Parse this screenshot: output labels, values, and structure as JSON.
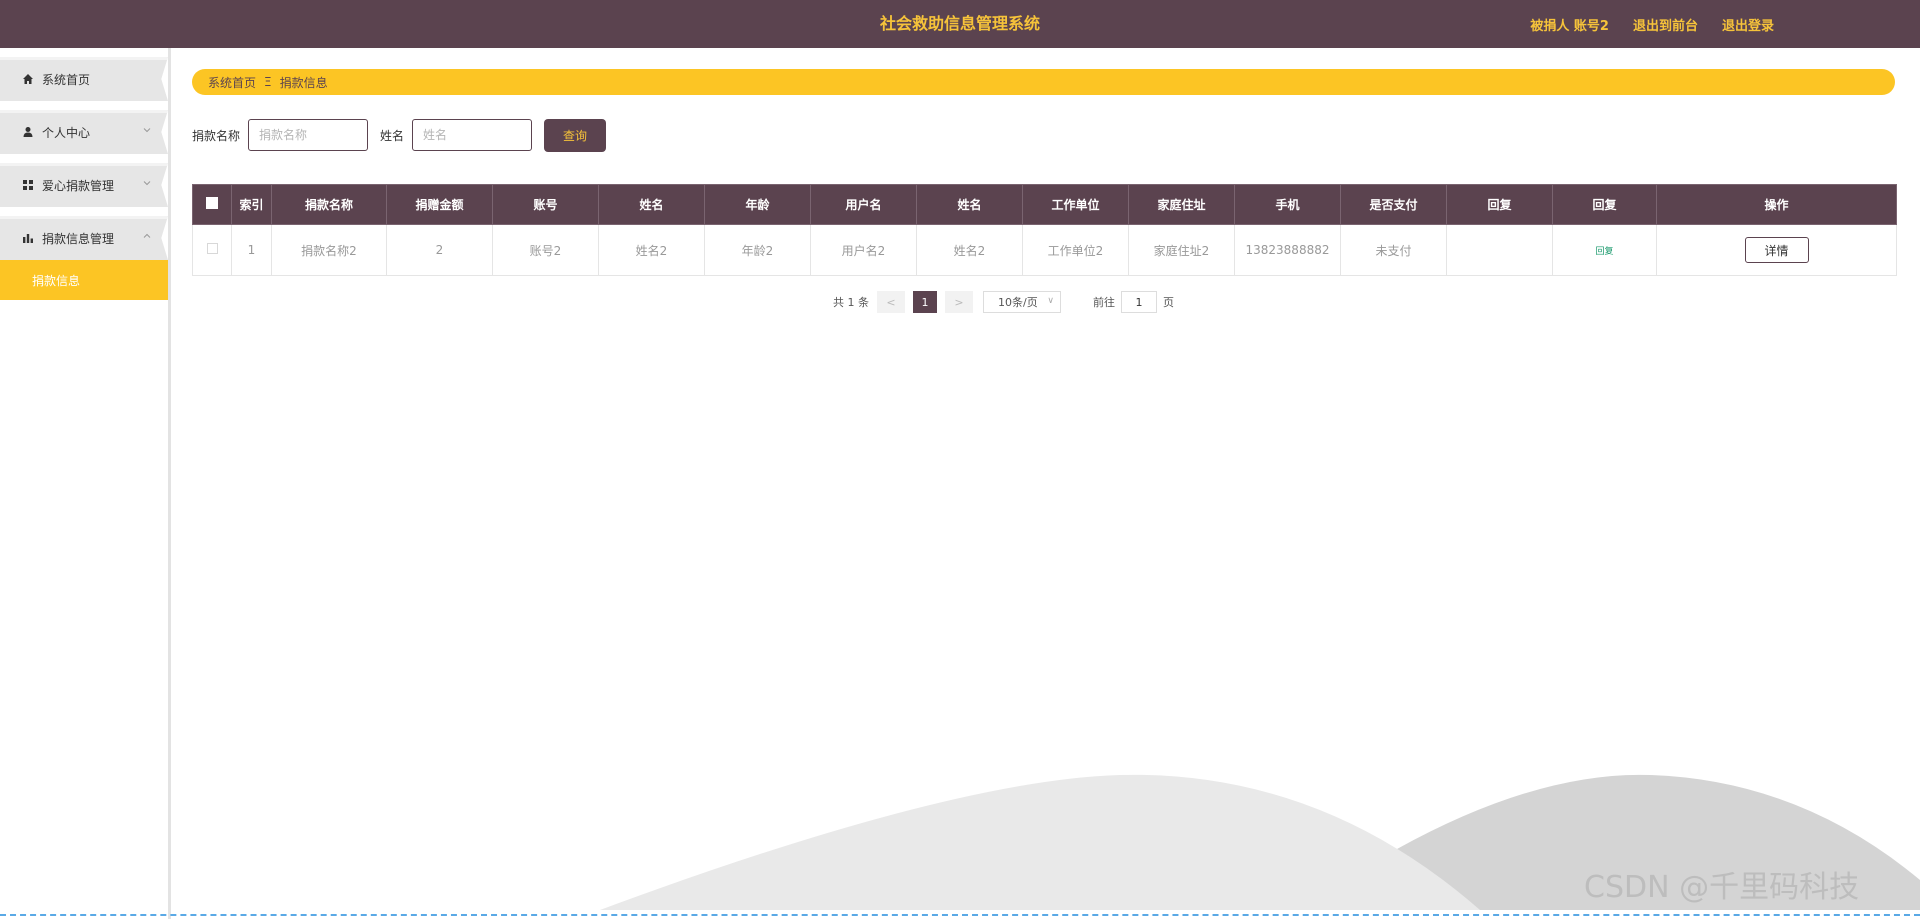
{
  "header": {
    "title": "社会救助信息管理系统",
    "user_label": "被捐人 账号2",
    "to_front": "退出到前台",
    "logout": "退出登录"
  },
  "sidebar": {
    "items": [
      {
        "label": "系统首页",
        "icon": "home-icon"
      },
      {
        "label": "个人中心",
        "icon": "user-icon"
      },
      {
        "label": "爱心捐款管理",
        "icon": "grid-icon"
      },
      {
        "label": "捐款信息管理",
        "icon": "bar-chart-icon"
      }
    ],
    "sub_active": "捐款信息"
  },
  "breadcrumb": {
    "home": "系统首页",
    "sep": "Ξ",
    "current": "捐款信息"
  },
  "search": {
    "field1_label": "捐款名称",
    "field1_placeholder": "捐款名称",
    "field2_label": "姓名",
    "field2_placeholder": "姓名",
    "button": "查询"
  },
  "table": {
    "headers": [
      "索引",
      "捐款名称",
      "捐赠金额",
      "账号",
      "姓名",
      "年龄",
      "用户名",
      "姓名",
      "工作单位",
      "家庭住址",
      "手机",
      "是否支付",
      "回复",
      "回复",
      "操作"
    ],
    "rows": [
      {
        "index": "1",
        "donation_name": "捐款名称2",
        "amount": "2",
        "account": "账号2",
        "name": "姓名2",
        "age": "年龄2",
        "username": "用户名2",
        "name2": "姓名2",
        "work_unit": "工作单位2",
        "address": "家庭住址2",
        "phone": "13823888882",
        "paid": "未支付",
        "reply": "",
        "reply_image": "回复",
        "action": "详情"
      }
    ]
  },
  "pagination": {
    "total": "共 1 条",
    "prev": "<",
    "current_page": "1",
    "next": ">",
    "page_size": "10条/页",
    "goto_label": "前往",
    "goto_value": "1",
    "page_suffix": "页"
  },
  "watermark": "CSDN @千里码科技",
  "colors": {
    "header_bg": "#5b434f",
    "accent": "#fcc524",
    "header_text": "#f6c33a"
  }
}
